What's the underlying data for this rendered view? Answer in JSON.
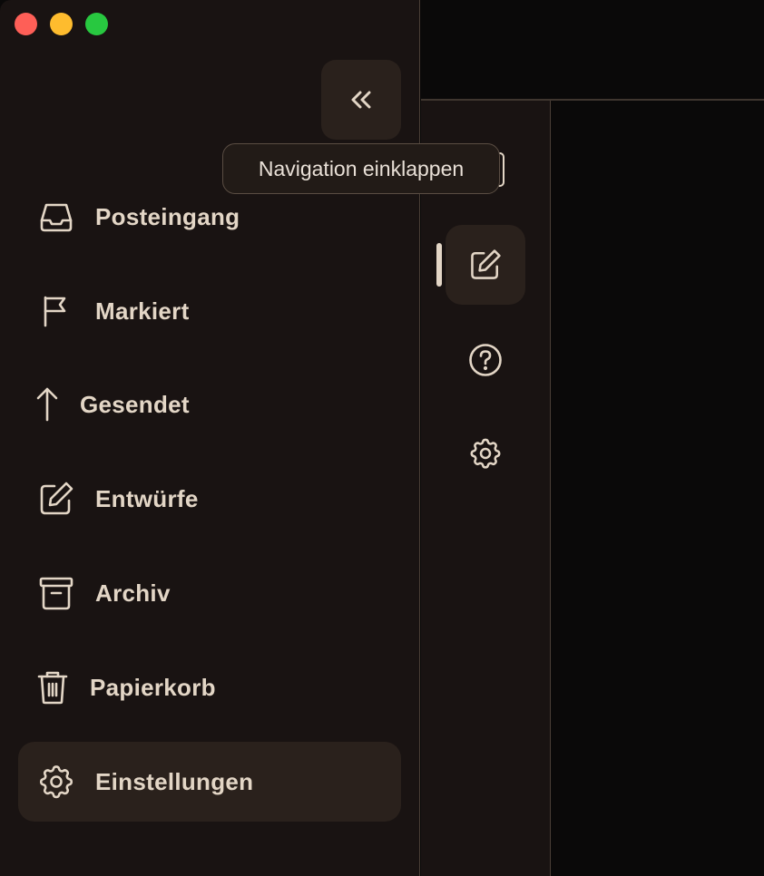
{
  "window": {
    "controls": [
      "close",
      "minimize",
      "zoom"
    ],
    "colors": {
      "close": "#fe5f57",
      "minimize": "#febc2e",
      "zoom": "#28c840"
    }
  },
  "sidebar": {
    "collapse_icon": "chevrons-left-icon",
    "tooltip": "Navigation einklappen",
    "items": [
      {
        "label": "Posteingang",
        "icon": "inbox-icon"
      },
      {
        "label": "Markiert",
        "icon": "flag-icon"
      },
      {
        "label": "Gesendet",
        "icon": "arrow-up-icon"
      },
      {
        "label": "Entwürfe",
        "icon": "edit-icon"
      },
      {
        "label": "Archiv",
        "icon": "archive-icon"
      },
      {
        "label": "Papierkorb",
        "icon": "trash-icon"
      },
      {
        "label": "Einstellungen",
        "icon": "gear-icon",
        "active": true
      }
    ]
  },
  "rail": {
    "items": [
      {
        "icon": "compose-icon",
        "active": true
      },
      {
        "icon": "help-icon"
      },
      {
        "icon": "gear-icon"
      }
    ]
  },
  "theme": {
    "accent_text": "#e3d6c6",
    "panel": "#191312",
    "active_bg": "#2a211c"
  }
}
